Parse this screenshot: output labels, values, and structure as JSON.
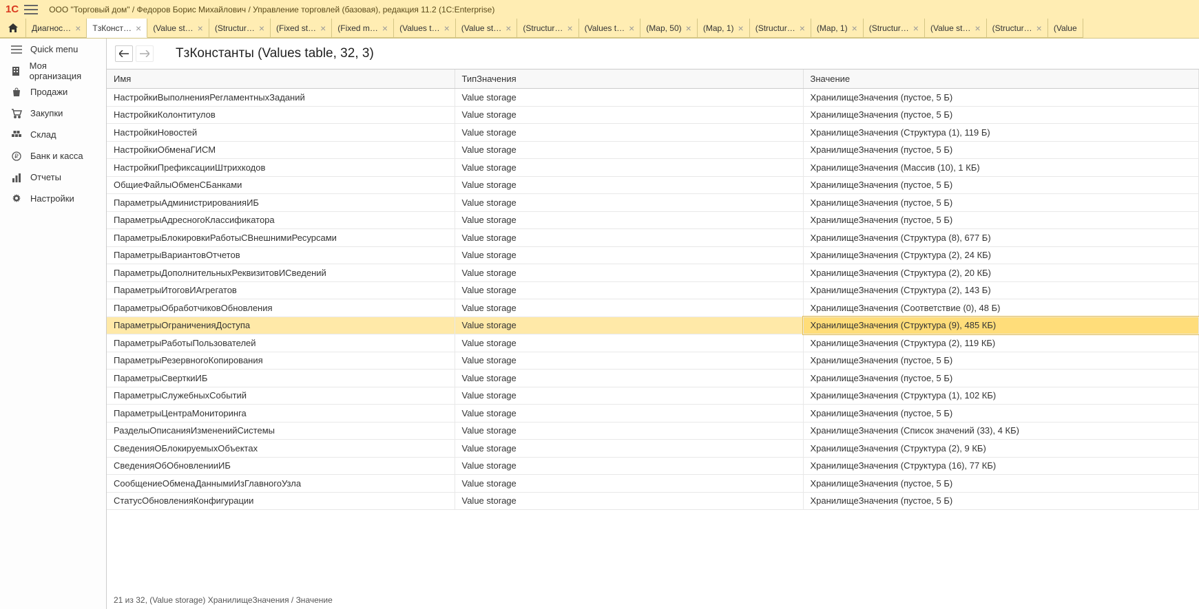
{
  "header": {
    "title": "ООО \"Торговый дом\" / Федоров Борис Михайлович / Управление торговлей (базовая), редакция 11.2  (1C:Enterprise)"
  },
  "tabs": [
    {
      "label": "Диагнос…",
      "active": false
    },
    {
      "label": "ТзКонст…",
      "active": true
    },
    {
      "label": "(Value st…",
      "active": false
    },
    {
      "label": "(Structur…",
      "active": false
    },
    {
      "label": "(Fixed st…",
      "active": false
    },
    {
      "label": "(Fixed m…",
      "active": false
    },
    {
      "label": "(Values t…",
      "active": false
    },
    {
      "label": "(Value st…",
      "active": false
    },
    {
      "label": "(Structur…",
      "active": false
    },
    {
      "label": "(Values t…",
      "active": false
    },
    {
      "label": "(Map, 50)",
      "active": false
    },
    {
      "label": "(Map, 1)",
      "active": false
    },
    {
      "label": "(Structur…",
      "active": false
    },
    {
      "label": "(Map, 1)",
      "active": false
    },
    {
      "label": "(Structur…",
      "active": false
    },
    {
      "label": "(Value st…",
      "active": false
    },
    {
      "label": "(Structur…",
      "active": false
    },
    {
      "label": "(Value",
      "active": false
    }
  ],
  "sidebar": {
    "items": [
      {
        "icon": "menu",
        "label": "Quick menu"
      },
      {
        "icon": "building",
        "label": "Моя организация"
      },
      {
        "icon": "bag",
        "label": "Продажи"
      },
      {
        "icon": "cart",
        "label": "Закупки"
      },
      {
        "icon": "warehouse",
        "label": "Склад"
      },
      {
        "icon": "ruble",
        "label": "Банк и касса"
      },
      {
        "icon": "chart",
        "label": "Отчеты"
      },
      {
        "icon": "gear",
        "label": "Настройки"
      }
    ]
  },
  "content": {
    "title": "ТзКонстанты (Values table, 32, 3)",
    "columns": [
      "Имя",
      "ТипЗначения",
      "Значение"
    ],
    "rows": [
      {
        "name": "НастройкиВыполненияРегламентныхЗаданий",
        "type": "Value storage",
        "value": "ХранилищеЗначения (пустое, 5 Б)"
      },
      {
        "name": "НастройкиКолонтитулов",
        "type": "Value storage",
        "value": "ХранилищеЗначения (пустое, 5 Б)"
      },
      {
        "name": "НастройкиНовостей",
        "type": "Value storage",
        "value": "ХранилищеЗначения (Структура (1), 119 Б)"
      },
      {
        "name": "НастройкиОбменаГИСМ",
        "type": "Value storage",
        "value": "ХранилищеЗначения (пустое, 5 Б)"
      },
      {
        "name": "НастройкиПрефиксацииШтрихкодов",
        "type": "Value storage",
        "value": "ХранилищеЗначения (Массив (10), 1 КБ)"
      },
      {
        "name": "ОбщиеФайлыОбменСБанками",
        "type": "Value storage",
        "value": "ХранилищеЗначения (пустое, 5 Б)"
      },
      {
        "name": "ПараметрыАдминистрированияИБ",
        "type": "Value storage",
        "value": "ХранилищеЗначения (пустое, 5 Б)"
      },
      {
        "name": "ПараметрыАдресногоКлассификатора",
        "type": "Value storage",
        "value": "ХранилищеЗначения (пустое, 5 Б)"
      },
      {
        "name": "ПараметрыБлокировкиРаботыСВнешнимиРесурсами",
        "type": "Value storage",
        "value": "ХранилищеЗначения (Структура (8), 677 Б)"
      },
      {
        "name": "ПараметрыВариантовОтчетов",
        "type": "Value storage",
        "value": "ХранилищеЗначения (Структура (2), 24 КБ)"
      },
      {
        "name": "ПараметрыДополнительныхРеквизитовИСведений",
        "type": "Value storage",
        "value": "ХранилищеЗначения (Структура (2), 20 КБ)"
      },
      {
        "name": "ПараметрыИтоговИАгрегатов",
        "type": "Value storage",
        "value": "ХранилищеЗначения (Структура (2), 143 Б)"
      },
      {
        "name": "ПараметрыОбработчиковОбновления",
        "type": "Value storage",
        "value": "ХранилищеЗначения (Соответствие (0), 48 Б)"
      },
      {
        "name": "ПараметрыОграниченияДоступа",
        "type": "Value storage",
        "value": "ХранилищеЗначения (Структура (9), 485 КБ)",
        "selected": true
      },
      {
        "name": "ПараметрыРаботыПользователей",
        "type": "Value storage",
        "value": "ХранилищеЗначения (Структура (2), 119 КБ)"
      },
      {
        "name": "ПараметрыРезервногоКопирования",
        "type": "Value storage",
        "value": "ХранилищеЗначения (пустое, 5 Б)"
      },
      {
        "name": "ПараметрыСверткиИБ",
        "type": "Value storage",
        "value": "ХранилищеЗначения (пустое, 5 Б)"
      },
      {
        "name": "ПараметрыСлужебныхСобытий",
        "type": "Value storage",
        "value": "ХранилищеЗначения (Структура (1), 102 КБ)"
      },
      {
        "name": "ПараметрыЦентраМониторинга",
        "type": "Value storage",
        "value": "ХранилищеЗначения (пустое, 5 Б)"
      },
      {
        "name": "РазделыОписанияИзмененийСистемы",
        "type": "Value storage",
        "value": "ХранилищеЗначения (Список значений (33), 4 КБ)"
      },
      {
        "name": "СведенияОБлокируемыхОбъектах",
        "type": "Value storage",
        "value": "ХранилищеЗначения (Структура (2), 9 КБ)"
      },
      {
        "name": "СведенияОбОбновленииИБ",
        "type": "Value storage",
        "value": "ХранилищеЗначения (Структура (16), 77 КБ)"
      },
      {
        "name": "СообщениеОбменаДаннымиИзГлавногоУзла",
        "type": "Value storage",
        "value": "ХранилищеЗначения (пустое, 5 Б)"
      },
      {
        "name": "СтатусОбновленияКонфигурации",
        "type": "Value storage",
        "value": "ХранилищеЗначения (пустое, 5 Б)"
      }
    ]
  },
  "status": "21 из 32,  (Value storage) ХранилищеЗначения / Значение"
}
